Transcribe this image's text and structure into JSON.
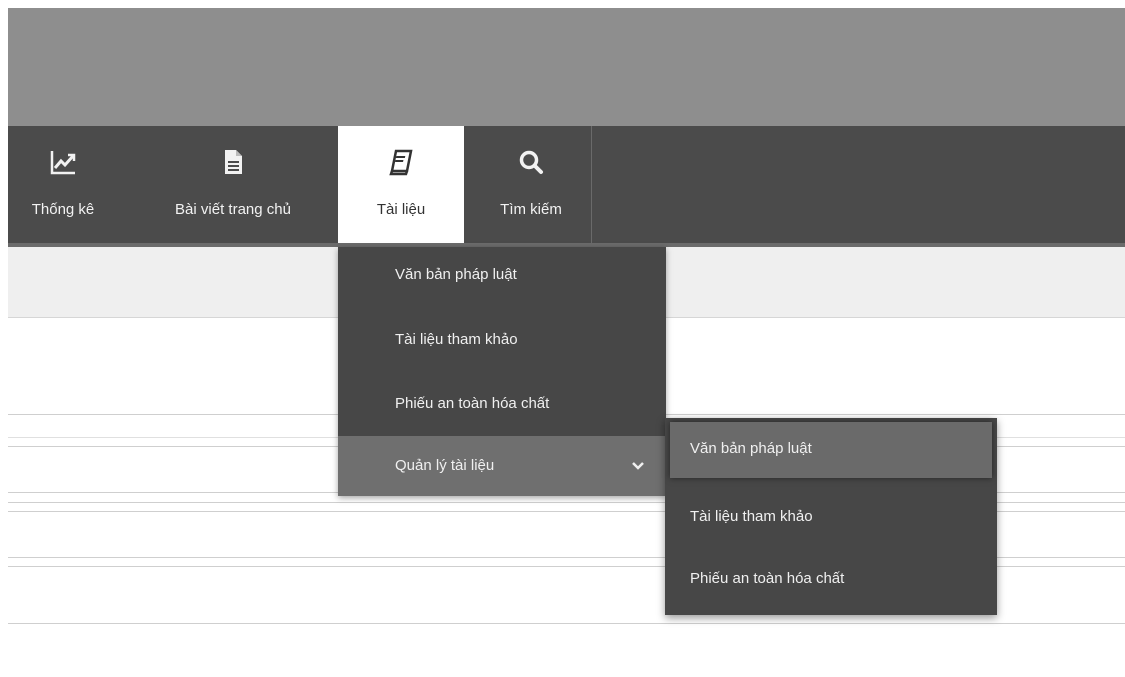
{
  "navbar": {
    "items": [
      {
        "label": "Thống kê",
        "icon": "line-chart-icon"
      },
      {
        "label": "Bài viết trang chủ",
        "icon": "document-icon"
      },
      {
        "label": "Tài liệu",
        "icon": "book-icon"
      },
      {
        "label": "Tìm kiếm",
        "icon": "search-icon"
      }
    ],
    "active": "Tài liệu"
  },
  "dropdown": {
    "items": [
      {
        "label": "Văn bản pháp luật"
      },
      {
        "label": "Tài liệu tham khảo"
      },
      {
        "label": "Phiếu an toàn hóa chất"
      },
      {
        "label": "Quản lý tài liệu",
        "icon": "chevron-down-icon"
      }
    ]
  },
  "submenu": {
    "items": [
      {
        "label": "Văn bản pháp luật"
      },
      {
        "label": "Tài liệu tham khảo"
      },
      {
        "label": "Phiếu an toàn hóa chất"
      }
    ]
  },
  "colors": {
    "banner": "#8e8e8e",
    "navbar": "#4b4b4b",
    "menu": "#474747",
    "menu_highlight": "#6f6f6f"
  }
}
